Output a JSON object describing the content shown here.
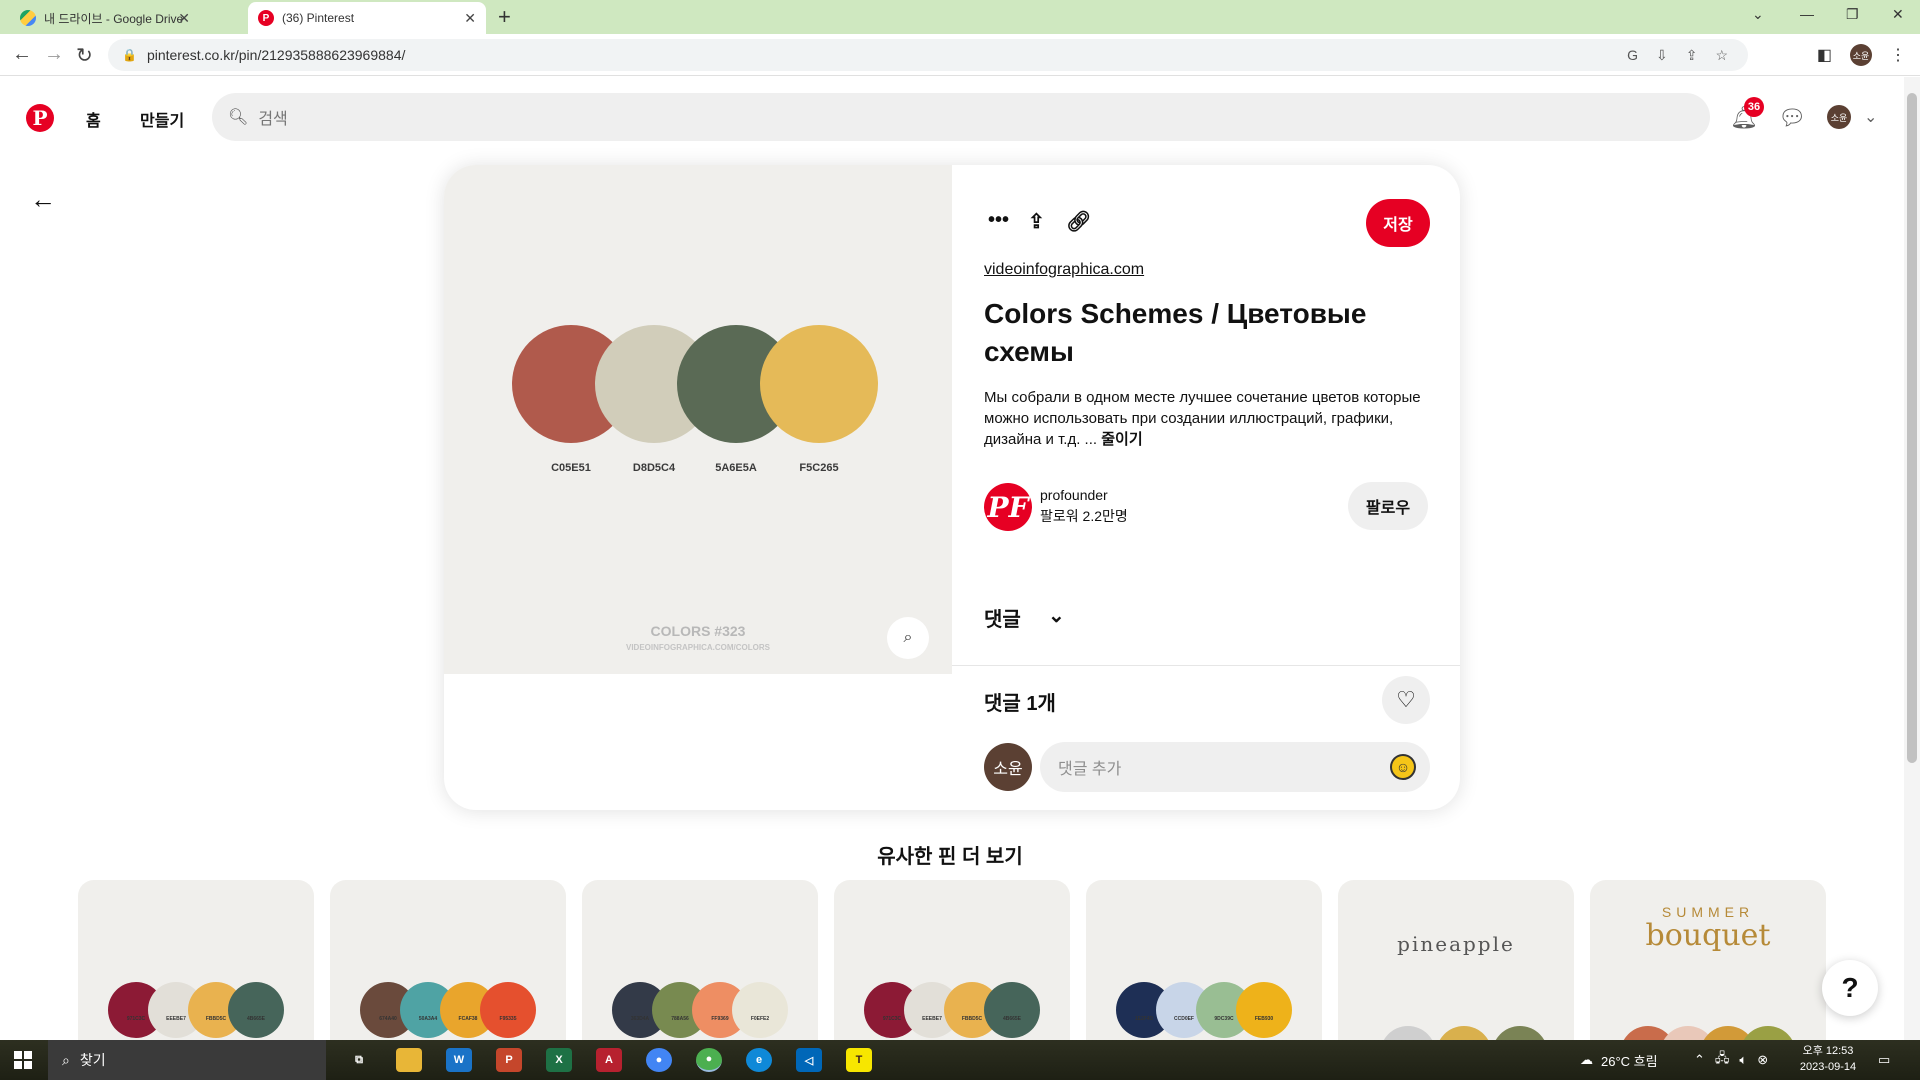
{
  "browser": {
    "tabs": [
      {
        "title": "내 드라이브 - Google Drive",
        "icon": "google-drive-icon"
      },
      {
        "title": "(36) Pinterest",
        "icon": "pinterest-icon"
      }
    ],
    "url": "pinterest.co.kr/pin/212935888623969884/",
    "profile_initials": "소윤"
  },
  "header": {
    "nav_home": "홈",
    "nav_create": "만들기",
    "search_placeholder": "검색",
    "notification_count": "36",
    "avatar_initials": "소윤"
  },
  "pin": {
    "image": {
      "colors": [
        {
          "hex": "#B05A4C",
          "code": "C05E51"
        },
        {
          "hex": "#D1CDBA",
          "code": "D8D5C4"
        },
        {
          "hex": "#5A6A55",
          "code": "5A6E5A"
        },
        {
          "hex": "#E5BA58",
          "code": "F5C265"
        }
      ],
      "title": "COLORS #323",
      "subtitle": "VIDEOINFOGRAPHICA.COM/COLORS"
    },
    "save_label": "저장",
    "source": "videoinfographica.com",
    "title": "Colors Schemes / Цветовые схемы",
    "description": "Мы собрали в одном месте лучшее сочетание цветов которые можно использовать при создании иллюстраций, графики, дизайна и т.д. ...",
    "less_label": "줄이기",
    "author": {
      "name": "profounder",
      "followers": "팔로워 2.2만명",
      "avatar_text": "PF"
    },
    "follow_label": "팔로우",
    "comments_header": "댓글",
    "comments_count": "댓글 1개",
    "comment_placeholder": "댓글 추가",
    "my_avatar": "소윤"
  },
  "more": {
    "title": "유사한 핀 더 보기",
    "thumbs": [
      {
        "colors": [
          "#8C1A35",
          "#E2DFD8",
          "#E9B24F",
          "#46655A"
        ],
        "codes": [
          "971C3C",
          "EEEBE7",
          "FBBD5C",
          "4B665E"
        ]
      },
      {
        "colors": [
          "#6A4A3C",
          "#4FA3A4",
          "#E9A52C",
          "#E5502E"
        ],
        "codes": [
          "674A40",
          "50A3A4",
          "FCAF38",
          "F95335"
        ]
      },
      {
        "colors": [
          "#333A48",
          "#788A50",
          "#EE8E63",
          "#E9E6D8"
        ],
        "codes": [
          "363D4A",
          "788A56",
          "FF9369",
          "F0EFE2"
        ]
      },
      {
        "colors": [
          "#8C1A35",
          "#E2DFD8",
          "#E9B24F",
          "#46655A"
        ],
        "codes": [
          "971C3C",
          "EEEBE7",
          "FBBD5C",
          "4B665E"
        ]
      },
      {
        "colors": [
          "#1E2F55",
          "#C8D5E8",
          "#99BE93",
          "#EEB21A"
        ],
        "codes": [
          "1E2F4D",
          "CCD0EF",
          "9DC39C",
          "FEB930"
        ]
      },
      {
        "word": "pineapple",
        "colors": [
          "#CFCFCF",
          "#D9B04D",
          "#7A8355"
        ]
      },
      {
        "word_top": "SUMMER",
        "word": "bouquet",
        "colors": [
          "#C96C4B",
          "#E9C8B9",
          "#D29A38",
          "#9AA044"
        ]
      }
    ]
  },
  "taskbar": {
    "search_label": "찾기",
    "weather": "26°C 흐림",
    "time": "오후 12:53",
    "date": "2023-09-14"
  }
}
